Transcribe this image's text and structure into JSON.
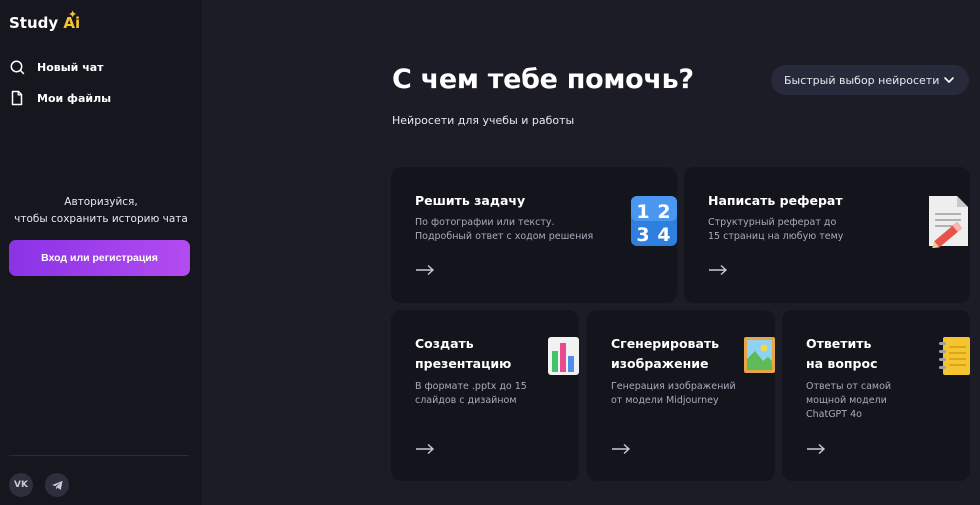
{
  "app": {
    "logo_text": "Study ",
    "logo_accent": "Ai",
    "logo_sparkle": "✦"
  },
  "sidebar": {
    "nav": [
      {
        "label": "Новый чат",
        "icon": "search-icon"
      },
      {
        "label": "Мои файлы",
        "icon": "file-icon"
      }
    ],
    "auth_line1": "Авторизуйся,",
    "auth_line2": "чтобы сохранить историю чата",
    "auth_button": "Вход или регистрация",
    "social": [
      {
        "icon": "vk-icon",
        "label": "VK"
      },
      {
        "icon": "telegram-icon"
      }
    ]
  },
  "main": {
    "title": "С чем тебе помочь?",
    "subtitle": "Нейросети для учебы и работы",
    "model_select": "Быстрый выбор нейросети",
    "cards": [
      {
        "title_lines": [
          "Решить задачу"
        ],
        "desc_lines": [
          "По фотографии или тексту.",
          "Подробный ответ с ходом решения"
        ],
        "icon": "numbers-icon"
      },
      {
        "title_lines": [
          "Написать реферат"
        ],
        "desc_lines": [
          "Структурный реферат до",
          "15 страниц на любую тему"
        ],
        "icon": "document-pencil-icon"
      },
      {
        "title_lines": [
          "Создать",
          "презентацию"
        ],
        "desc_lines": [
          "В формате .pptx до 15",
          "слайдов с дизайном"
        ],
        "icon": "bar-chart-icon"
      },
      {
        "title_lines": [
          "Сгенерировать",
          "изображение"
        ],
        "desc_lines": [
          "Генерация изображений",
          "от модели Midjourney"
        ],
        "icon": "picture-icon"
      },
      {
        "title_lines": [
          "Ответить",
          "на вопрос"
        ],
        "desc_lines": [
          "Ответы от самой",
          "мощной модели",
          "ChatGPT 4o"
        ],
        "icon": "notepad-icon"
      }
    ]
  },
  "colors": {
    "background": "#1b1c26",
    "sidebar": "#15161e",
    "card": "#13141c",
    "accent_gradient_start": "#8a33e6",
    "accent_gradient_end": "#b34cf0",
    "logo_accent": "#f5c531",
    "muted_text": "#a9abbb"
  }
}
